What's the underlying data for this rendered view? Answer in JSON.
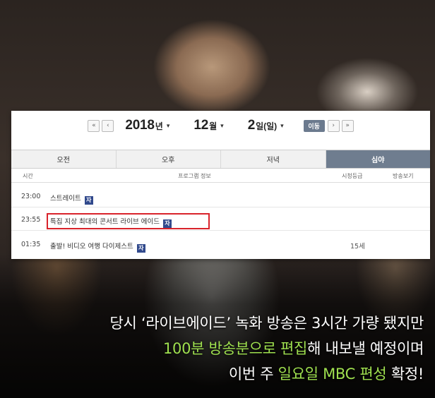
{
  "schedule": {
    "date": {
      "first_label": "«",
      "prev_label": "‹",
      "year": "2018",
      "year_unit": "년",
      "month": "12",
      "month_unit": "월",
      "day": "2",
      "day_unit": "일(일)",
      "caret": "▾",
      "go_label": "이동",
      "next_label": "›",
      "last_label": "»"
    },
    "tabs": [
      {
        "label": "오전",
        "active": false
      },
      {
        "label": "오후",
        "active": false
      },
      {
        "label": "저녁",
        "active": false
      },
      {
        "label": "심야",
        "active": true
      }
    ],
    "columns": {
      "time": "시간",
      "info": "프로그램 정보",
      "rating": "시청등급",
      "watch": "방송보기"
    },
    "rows": [
      {
        "time": "23:00",
        "title": "스트레이트",
        "badge": "자",
        "rating": ""
      },
      {
        "time": "23:55",
        "title": "특집 지상 최대의 콘서트 라이브 에이드",
        "badge": "자",
        "rating": ""
      },
      {
        "time": "01:35",
        "title": "출발! 비디오 여행 다이제스트",
        "badge": "자",
        "rating": "15세"
      }
    ],
    "colors": {
      "active_tab": "#6f7d8f",
      "badge": "#31498c",
      "highlight_border": "#d9232b"
    }
  },
  "subtitles": {
    "line1": "당시 ‘라이브에이드’ 녹화 방송은 3시간 가량 됐지만",
    "line2_hl": "100분 방송분으로 편집",
    "line2_rest": "해 내보낼 예정이며",
    "line3_pre": "이번 주 ",
    "line3_hl": "일요일 MBC 편성",
    "line3_post": " 확정!",
    "highlight_color": "#9fe04f"
  }
}
